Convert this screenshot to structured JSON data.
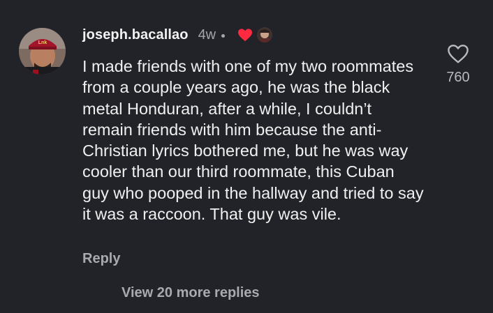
{
  "comment": {
    "username": "joseph.bacallao",
    "time": "4w",
    "text": "I made friends with one of my two roommates from a couple years ago, he was the black metal Honduran, after a while, I couldn’t remain friends with him because the anti-Christian lyrics bothered me, but he was way cooler than our third roommate, this Cuban guy who pooped in the hallway and tried to say it was a raccoon. That guy was vile.",
    "reply_label": "Reply",
    "like_count": "760",
    "view_more_label": "View 20 more replies"
  },
  "icons": {
    "like": "heart-outline-icon",
    "creator_liked": "heart-filled-icon"
  },
  "colors": {
    "background": "#212328",
    "primary_text": "#f0f0f0",
    "secondary_text": "#a8aaaf",
    "creator_heart": "#ff2a3f"
  }
}
